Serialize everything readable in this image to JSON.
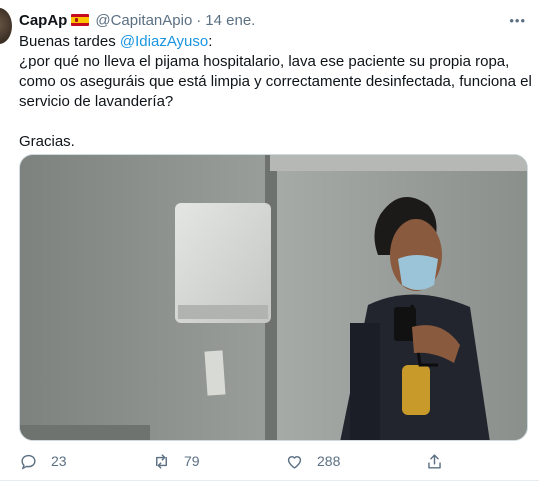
{
  "tweet": {
    "display_name": "CapAp",
    "flag_icon": "spain-flag-icon",
    "handle": "@CapitanApio",
    "separator": "·",
    "date": "14 ene.",
    "more": "•••",
    "lines": [
      "Buenas tardes ",
      "¿por qué no lleva el pijama hospitalario, lava ese paciente su propia ropa,",
      "como os aseguráis que está limpia y correctamente desinfectada, funciona el",
      "servicio de lavandería?"
    ],
    "mention": "@IdiazAyuso",
    "colon": ":",
    "closing": "Gracias."
  },
  "actions": {
    "reply_count": "23",
    "retweet_count": "79",
    "like_count": "288"
  },
  "colors": {
    "link": "#1b95e0",
    "secondary_text": "#5b7083"
  }
}
